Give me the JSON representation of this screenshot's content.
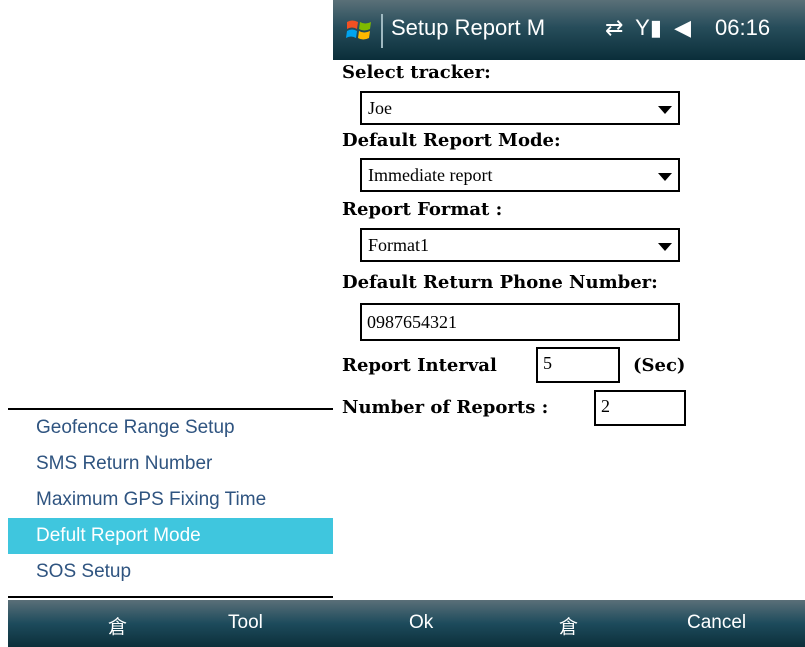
{
  "left_screen": {
    "menu_items": [
      {
        "label": "Geofence Range Setup"
      },
      {
        "label": "SMS Return Number"
      },
      {
        "label": "Maximum GPS Fixing Time"
      },
      {
        "label": "Defult Report Mode"
      },
      {
        "label": "SOS Setup"
      }
    ],
    "softkeys": {
      "center": "倉",
      "right": "Tool"
    }
  },
  "right_screen": {
    "title": "Setup Report M",
    "status": {
      "time": "06:16",
      "icons": [
        "sync-icon",
        "signal-icon",
        "volume-icon"
      ]
    },
    "form": {
      "tracker_label": "Select tracker:",
      "tracker_value": "Joe",
      "mode_label": "Default Report Mode:",
      "mode_value": "Immediate report",
      "format_label": "Report Format :",
      "format_value": "Format1",
      "phone_label": "Default Return Phone Number:",
      "phone_value": "0987654321",
      "interval_label": "Report Interval",
      "interval_value": "5",
      "interval_unit": "(Sec)",
      "count_label": "Number of Reports :",
      "count_value": "2"
    },
    "softkeys": {
      "left": "Ok",
      "center": "倉",
      "right": "Cancel"
    }
  },
  "colors": {
    "selection": "#3fc6de",
    "menu_text": "#2f5480",
    "bar_top": "#5a7078",
    "bar_bottom": "#0a2e3a"
  }
}
